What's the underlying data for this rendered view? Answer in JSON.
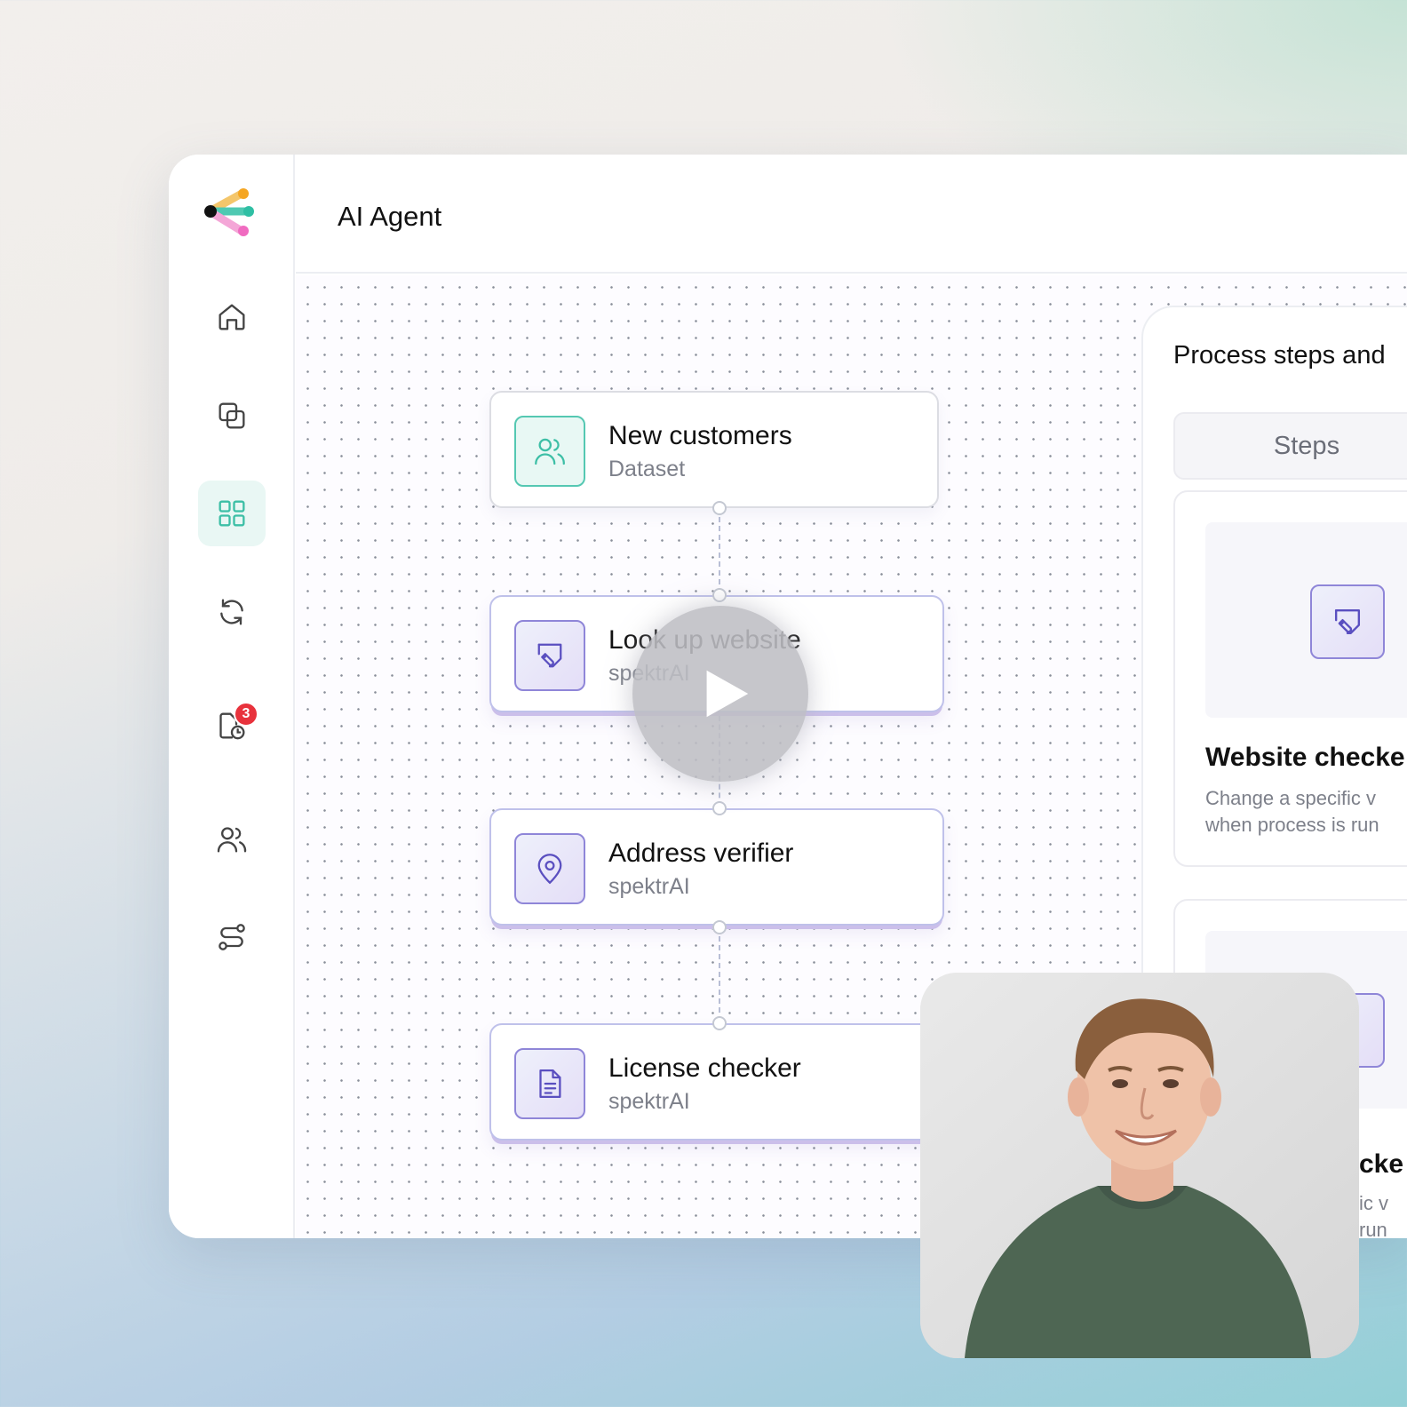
{
  "header": {
    "title": "AI Agent"
  },
  "sidebar": {
    "items": [
      {
        "name": "home",
        "icon": "home-icon"
      },
      {
        "name": "layers",
        "icon": "copy-icon"
      },
      {
        "name": "dashboard",
        "icon": "grid-icon",
        "active": true
      },
      {
        "name": "sync",
        "icon": "refresh-icon"
      },
      {
        "name": "scheduled",
        "icon": "file-clock-icon",
        "badge": "3"
      },
      {
        "name": "users",
        "icon": "users-icon"
      },
      {
        "name": "workflows",
        "icon": "route-icon"
      }
    ]
  },
  "flow": {
    "nodes": [
      {
        "title": "New customers",
        "subtitle": "Dataset",
        "icon": "users-icon"
      },
      {
        "title": "Look up website",
        "subtitle": "spektrAI",
        "icon": "tag-icon"
      },
      {
        "title": "Address verifier",
        "subtitle": "spektrAI",
        "icon": "map-pin-icon"
      },
      {
        "title": "License checker",
        "subtitle": "spektrAI",
        "icon": "document-icon"
      }
    ]
  },
  "panel": {
    "title": "Process steps and",
    "tab_label": "Steps",
    "cards": [
      {
        "title": "Website checke",
        "desc_line1": "Change a specific v",
        "desc_line2": "when process is run"
      },
      {
        "title": "cke",
        "desc_line1": "ic v",
        "desc_line2": "run"
      }
    ]
  },
  "colors": {
    "accent": "#55c8b2",
    "violet": "#8f86d8",
    "badge": "#e8323c"
  }
}
